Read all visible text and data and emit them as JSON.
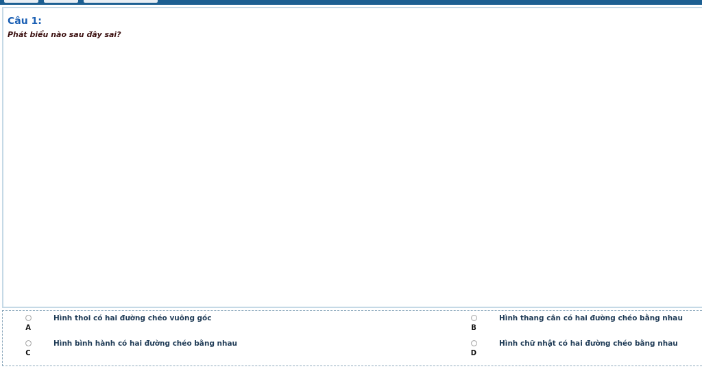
{
  "question": {
    "number": "Câu 1:",
    "prompt": "Phát biểu nào sau đây sai?"
  },
  "options": [
    {
      "letter": "A",
      "text": "Hình thoi có hai đường chéo vuông góc",
      "selected": false
    },
    {
      "letter": "B",
      "text": "Hình thang cân có hai đường chéo bằng nhau",
      "selected": false
    },
    {
      "letter": "C",
      "text": "Hình bình hành có hai đường chéo bằng nhau",
      "selected": false
    },
    {
      "letter": "D",
      "text": "Hình chữ nhật có hai đường chéo bằng nhau",
      "selected": false
    }
  ]
}
